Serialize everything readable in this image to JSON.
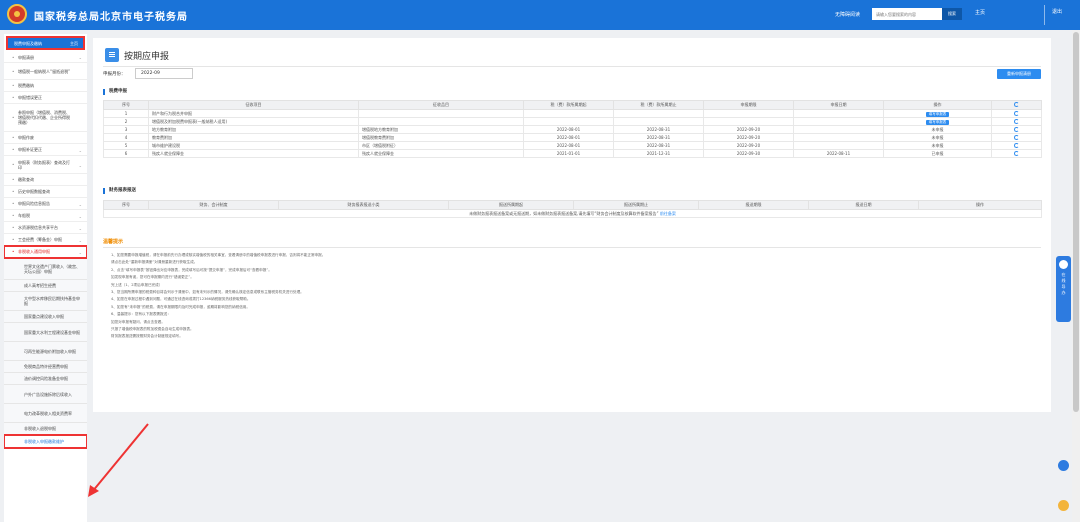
{
  "header": {
    "site_title": "国家税务总局北京市电子税务局",
    "barrier_free": "无障碍阅读",
    "search_placeholder": "请输入您要搜索的内容",
    "search_button": "搜索",
    "user_label": "主页",
    "logout": "退出"
  },
  "sidebar": {
    "top_label": "税费申报及缴纳",
    "home": "主页",
    "menu": [
      {
        "label": "申报清册",
        "chev": true,
        "h": 11
      },
      {
        "label": "增值税一般纳税人“留抵退税”",
        "chev": false,
        "h": 17
      },
      {
        "label": "税费缴纳",
        "chev": false,
        "h": 12
      },
      {
        "label": "申报错误更正",
        "chev": false,
        "h": 12
      },
      {
        "label": "参照申报（增值税、消费税、增值税代扣代缴、企业所得税预缴）",
        "chev": false,
        "h": 28
      },
      {
        "label": "申报作废",
        "chev": false,
        "h": 12
      },
      {
        "label": "申报补证更正",
        "chev": true,
        "h": 12
      },
      {
        "label": "申报表（财务报表）查询及打印",
        "chev": true,
        "h": 18
      },
      {
        "label": "缴款查询",
        "chev": false,
        "h": 12
      },
      {
        "label": "历史申报数据查询",
        "chev": false,
        "h": 12
      },
      {
        "label": "申报风险信息报告",
        "chev": true,
        "h": 12
      },
      {
        "label": "车船税",
        "chev": true,
        "h": 12
      },
      {
        "label": "水资源税信息共享平台",
        "chev": true,
        "h": 12
      },
      {
        "label": "工会经费（筹备金）申报",
        "chev": true,
        "h": 12
      },
      {
        "label": "非税收入通用申报",
        "chev": true,
        "h": 12,
        "red": true
      }
    ],
    "submenu": [
      {
        "label": "世界文化遗产门票收入（故宫、天坛公园）申报",
        "h": 22
      },
      {
        "label": "成人高考招生经费",
        "h": 12
      },
      {
        "label": "大中型水库移民后期扶持基金申报",
        "h": 19
      },
      {
        "label": "国家重点建设收入申报",
        "h": 12
      },
      {
        "label": "国家重大水利工程建设基金申报",
        "h": 19
      },
      {
        "label": "可再生能源电价附加收入申报",
        "h": 19
      },
      {
        "label": "免税商品特许经营费申报",
        "h": 12
      },
      {
        "label": "油价调控风险准备金申报",
        "h": 12
      },
      {
        "label": "户外广告设施拆除后续收入",
        "h": 19
      },
      {
        "label": "电力改革税收入相关资费率",
        "h": 19
      },
      {
        "label": "非税收入退税申报",
        "h": 12
      },
      {
        "label": "非税收入申报缴款维护",
        "h": 13,
        "sel": true
      }
    ]
  },
  "main": {
    "page_title": "按期应申报",
    "period_label": "申报月份：",
    "period_value": "2022-09",
    "recalc_button": "重新申报清册",
    "section1": "税费申报",
    "table1_headers": [
      "序号",
      "征收项目",
      "征收品目",
      "税（费）款所属期起",
      "税（费）款所属期止",
      "申报期限",
      "申报日期",
      "操作",
      ""
    ],
    "table1_rows": [
      [
        "1",
        "财产和行为税合并申报",
        "",
        "",
        "",
        "",
        "",
        "填写申报表",
        ""
      ],
      [
        "2",
        "增值税及附加税费申报表(一般纳税人适用)",
        "",
        "",
        "",
        "",
        "",
        "填写申报表",
        ""
      ],
      [
        "3",
        "地方教育附加",
        "增值税地方教育附加",
        "2022-08-01",
        "2022-08-31",
        "2022-09-20",
        "",
        "未申报",
        ""
      ],
      [
        "4",
        "教育费附加",
        "增值税教育费附加",
        "2022-08-01",
        "2022-08-31",
        "2022-09-20",
        "",
        "未申报",
        ""
      ],
      [
        "5",
        "城市维护建设税",
        "市区（增值税附征）",
        "2022-08-01",
        "2022-08-31",
        "2022-09-20",
        "",
        "未申报",
        ""
      ],
      [
        "6",
        "残疾人就业保障金",
        "残疾人就业保障金",
        "2021-01-01",
        "2021-12-31",
        "2022-09-30",
        "2022-08-11",
        "已申报",
        ""
      ]
    ],
    "section2": "财务报表报送",
    "table2_headers": [
      "序号",
      "财务、会计制度",
      "财务报表报送小类",
      "报送所属期起",
      "报送所属期止",
      "报送期限",
      "报送日期",
      "操作"
    ],
    "table2_empty": "未做财务报表报送备案或无报送期，如未做财务报表报送备案,请先填写“财务会计制度及核算软件备案报告”",
    "table2_empty_link": "前往备案",
    "tips_title": "温馨提示",
    "tips": [
      "1、如您需要申报增值税，请在申报前先行办理或核实增值税的相关事宜，查看清册中的增值税申报表进行申报，否则将不能正常申报。",
      "请点击此处“重新申报清册”对清册重新进行获取生成。",
      "2、点击“填写申报表”按钮弹出对应申报表，完成填写后可按“提交申报”，完成申报后可“查看申报”。",
      "如发现申报有误，您可在申报期内进行“错误更正”。",
      "完上述（1、2项后申报已完成）",
      "3、您当期所需申报的税费种目将会列示于清册中，如有未列示的情况，请先确认核定信息或联系主管税务机关进行处理。",
      "4、如您在申报过程中遇到问题，可通过在线咨询或拨打12366纳税服务热线获取帮助。",
      "5、如您有“未申报”的税费，请在申报期限内及时完成申报，逾期将影响您的纳税信用。",
      "6、温馨提示：您有以下报表需报送：",
      "如您对申报有疑问，请点击查看。",
      "只报了增值税申报表的附加税费会自动生成申报表。",
      "财务报表报送需按照财务会计制度规定填写。"
    ]
  },
  "float_widget": {
    "text": "在线导办"
  }
}
